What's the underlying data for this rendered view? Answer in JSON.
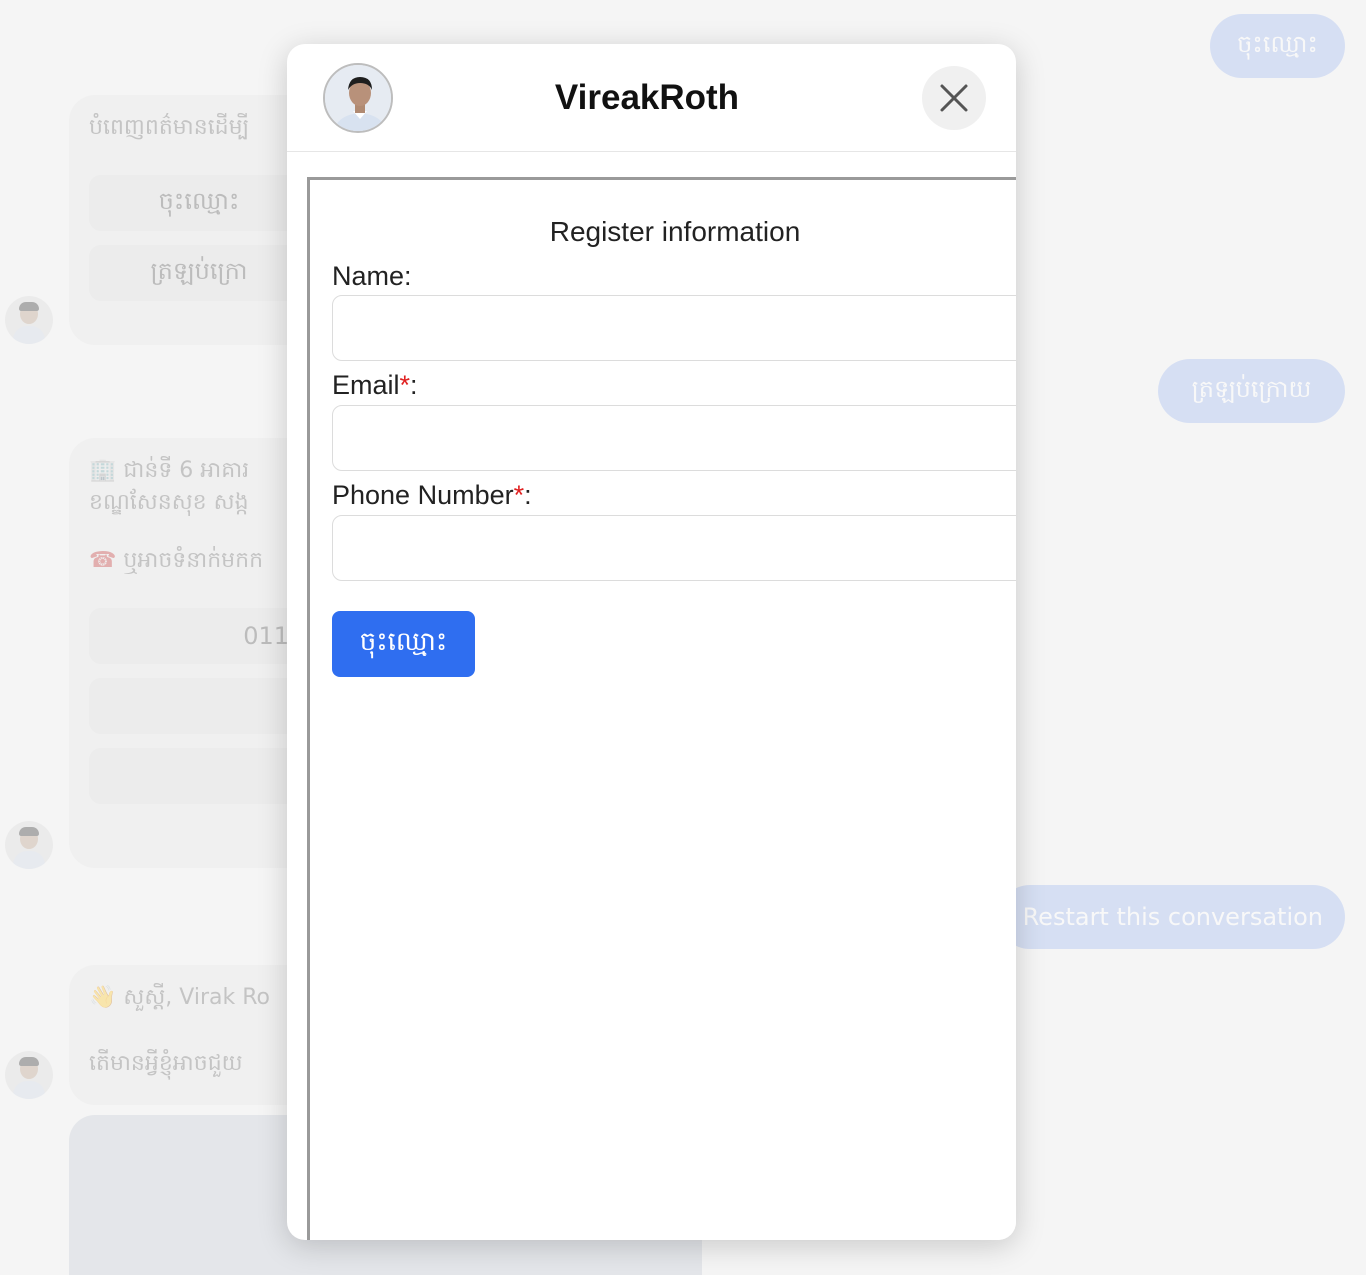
{
  "background_chat": {
    "user_bubbles": [
      {
        "label": "ចុះឈ្មោះ"
      },
      {
        "label": "ត្រឡប់ក្រោយ"
      },
      {
        "label": "Restart this conversation"
      }
    ],
    "card1": {
      "text": "បំពេញពត៌មានដើម្បី",
      "buttons": [
        "ចុះឈ្មោះ",
        "ត្រឡប់ក្រោ"
      ]
    },
    "card2": {
      "address_icon": "🏢",
      "address_line1": "ជាន់ទី 6 អាគារ",
      "address_line2": "ខណ្ឌសែនសុខ សង្ក",
      "phone_icon": "☎",
      "phone_text": "ឬអាចទំនាក់មកក",
      "buttons": [
        "011",
        "",
        ""
      ]
    },
    "card3": {
      "greeting_icon": "👋",
      "greeting": "សួស្តី, Virak Ro",
      "question": "តើមានអ្វីខ្ញុំអាចជួយ"
    }
  },
  "modal": {
    "title": "VireakRoth",
    "avatar_icon": "avatar-photo",
    "close_icon": "close-x-icon"
  },
  "form": {
    "heading": "Register information",
    "fields": [
      {
        "label": "Name",
        "required": false,
        "value": ""
      },
      {
        "label": "Email",
        "required": true,
        "value": ""
      },
      {
        "label": "Phone Number",
        "required": true,
        "value": ""
      }
    ],
    "required_marker": "*",
    "colon": ":",
    "submit_label": "ចុះឈ្មោះ"
  },
  "colors": {
    "accent": "#2f6ef0",
    "required": "#e02020",
    "user_bubble": "#9db7f2"
  }
}
